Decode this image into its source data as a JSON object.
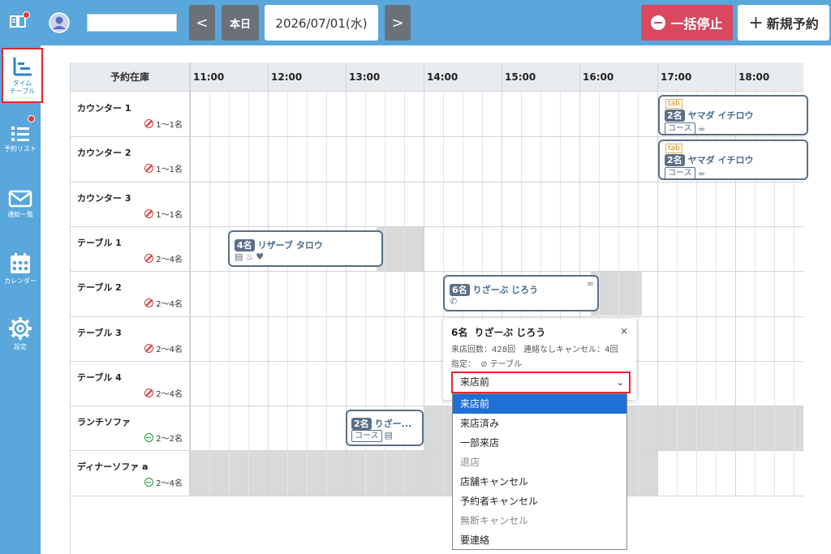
{
  "topbar": {
    "date": "2026/07/01(水)",
    "today_label": "本日",
    "prev_label": "<",
    "next_label": ">",
    "stop_label": "一括停止",
    "new_label": "新規予約",
    "bg_color": "#59a7db"
  },
  "sidebar": {
    "items": [
      {
        "label": "タイム\nテーブル",
        "icon": "timetable-icon",
        "active": true
      },
      {
        "label": "予約リスト",
        "icon": "list-icon",
        "badge": true
      },
      {
        "label": "通知一覧",
        "icon": "mail-icon"
      },
      {
        "label": "カレンダー",
        "icon": "calendar-icon"
      },
      {
        "label": "設定",
        "icon": "gear-icon"
      }
    ]
  },
  "grid": {
    "header_label": "予約在庫",
    "times": [
      "11:00",
      "12:00",
      "13:00",
      "14:00",
      "15:00",
      "16:00",
      "17:00",
      "18:00"
    ],
    "rooms": [
      {
        "name": "カウンター 1",
        "capacity": "1〜1名",
        "smoking": false
      },
      {
        "name": "カウンター 2",
        "capacity": "1〜1名",
        "smoking": false
      },
      {
        "name": "カウンター 3",
        "capacity": "1〜1名",
        "smoking": false
      },
      {
        "name": "テーブル 1",
        "capacity": "2〜4名",
        "smoking": false
      },
      {
        "name": "テーブル 2",
        "capacity": "2〜4名",
        "smoking": false
      },
      {
        "name": "テーブル 3",
        "capacity": "2〜4名",
        "smoking": false
      },
      {
        "name": "テーブル 4",
        "capacity": "2〜4名",
        "smoking": false
      },
      {
        "name": "ランチソファ",
        "capacity": "2〜2名",
        "smoking": true
      },
      {
        "name": "ディナーソファ a",
        "capacity": "2〜4名",
        "smoking": true
      }
    ]
  },
  "reservations": {
    "r1": {
      "count": "2名",
      "name": "ヤマダ イチロウ",
      "tag": "tab",
      "course": "コース"
    },
    "r2": {
      "count": "2名",
      "name": "ヤマダ イチロウ",
      "tag": "tab",
      "course": "コース"
    },
    "r3": {
      "count": "4名",
      "name": "リザーブ タロウ"
    },
    "r4": {
      "count": "6名",
      "name": "りざーぶ じろう"
    },
    "r5": {
      "count": "2名",
      "name": "りざー...",
      "course": "コース"
    }
  },
  "popover": {
    "title_count": "6名",
    "title_name": "りざーぶ じろう",
    "close": "×",
    "visits": "来店回数：428回　連絡なしキャンセル：4回",
    "designation_label": "指定：",
    "designation_value": "テーブル",
    "selected_status": "来店前",
    "options": [
      {
        "label": "来店前",
        "state": "selected"
      },
      {
        "label": "来店済み",
        "state": "normal"
      },
      {
        "label": "一部来店",
        "state": "normal"
      },
      {
        "label": "退店",
        "state": "disabled"
      },
      {
        "label": "店舗キャンセル",
        "state": "normal"
      },
      {
        "label": "予約者キャンセル",
        "state": "normal"
      },
      {
        "label": "無断キャンセル",
        "state": "disabled"
      },
      {
        "label": "要連絡",
        "state": "normal"
      }
    ]
  }
}
